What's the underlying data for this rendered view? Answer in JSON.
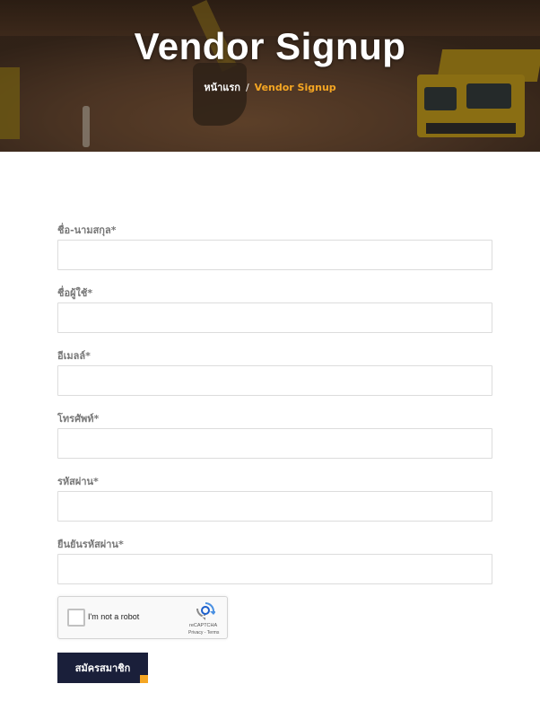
{
  "hero": {
    "title": "Vendor Signup",
    "breadcrumb": {
      "home": "หน้าแรก",
      "separator": "/",
      "current": "Vendor Signup"
    }
  },
  "form": {
    "fields": [
      {
        "label": "ชื่อ-นามสกุล*",
        "value": "",
        "placeholder": ""
      },
      {
        "label": "ชื่อผู้ใช้*",
        "value": "",
        "placeholder": ""
      },
      {
        "label": "อีเมลล์*",
        "value": "",
        "placeholder": ""
      },
      {
        "label": "โทรศัพท์*",
        "value": "",
        "placeholder": ""
      },
      {
        "label": "รหัสผ่าน*",
        "value": "",
        "placeholder": ""
      },
      {
        "label": "ยืนยันรหัสผ่าน*",
        "value": "",
        "placeholder": ""
      }
    ],
    "recaptcha": {
      "label": "I'm not a robot",
      "brand": "reCAPTCHA",
      "terms": "Privacy - Terms",
      "checked": false
    },
    "submit_label": "สมัครสมาชิก"
  },
  "colors": {
    "accent": "#f5a623",
    "button_bg": "#1a1f3a",
    "label_text": "#777777",
    "input_border": "#dcdcdc"
  }
}
